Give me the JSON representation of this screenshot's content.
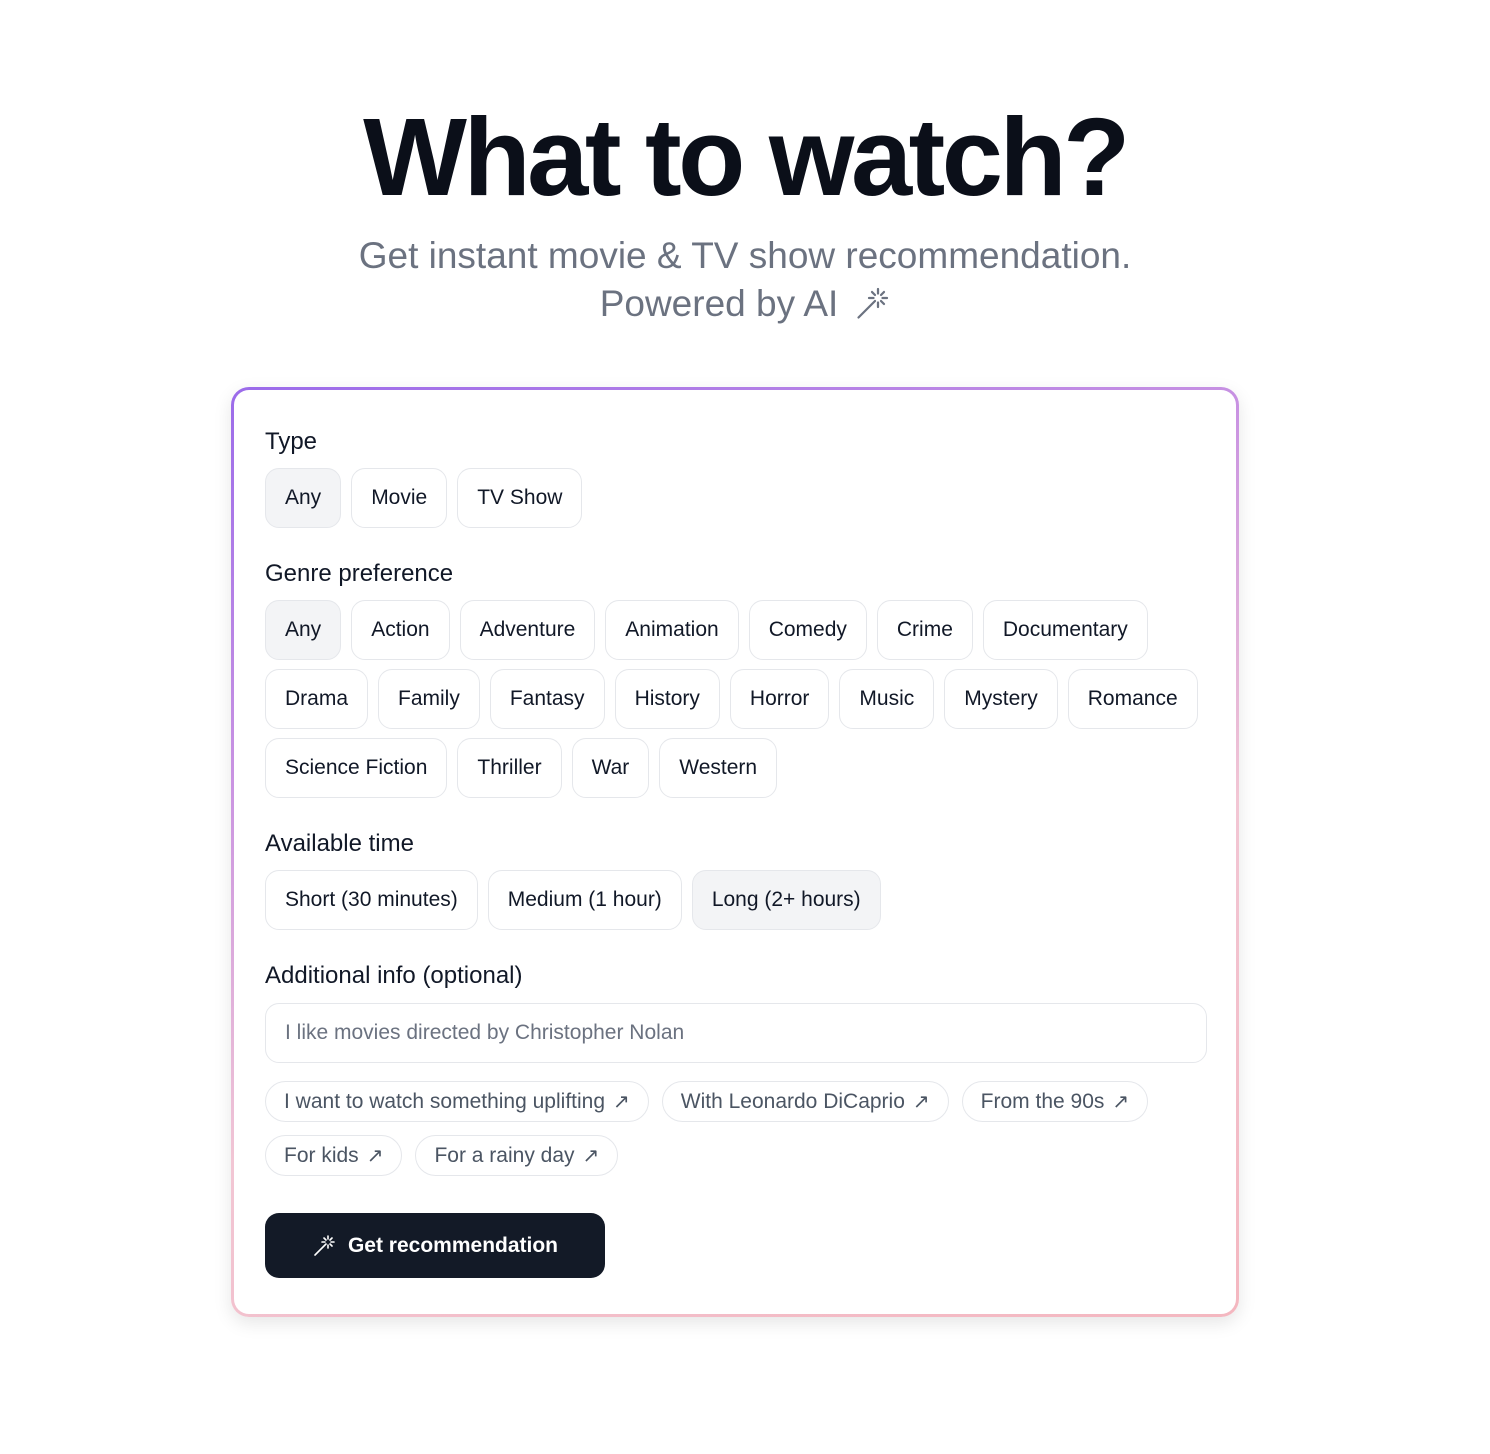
{
  "hero": {
    "title": "What to watch?",
    "subtitle_line1": "Get instant movie & TV show recommendation.",
    "subtitle_line2": "Powered by AI",
    "subtitle_icon": "magic-wand-icon"
  },
  "form": {
    "type": {
      "label": "Type",
      "options": [
        "Any",
        "Movie",
        "TV Show"
      ],
      "selected": "Any"
    },
    "genre": {
      "label": "Genre preference",
      "options": [
        "Any",
        "Action",
        "Adventure",
        "Animation",
        "Comedy",
        "Crime",
        "Documentary",
        "Drama",
        "Family",
        "Fantasy",
        "History",
        "Horror",
        "Music",
        "Mystery",
        "Romance",
        "Science Fiction",
        "Thriller",
        "War",
        "Western"
      ],
      "selected": "Any"
    },
    "time": {
      "label": "Available time",
      "options": [
        "Short (30 minutes)",
        "Medium (1 hour)",
        "Long (2+ hours)"
      ],
      "selected": "Long (2+ hours)"
    },
    "additional": {
      "label": "Additional info (optional)",
      "placeholder": "I like movies directed by Christopher Nolan",
      "value": "",
      "suggestions": [
        "I want to watch something uplifting",
        "With Leonardo DiCaprio",
        "From the 90s",
        "For kids",
        "For a rainy day"
      ],
      "suggestion_arrow": "↗"
    },
    "submit": {
      "label": "Get recommendation",
      "icon": "magic-wand-icon"
    }
  },
  "colors": {
    "primary_button": "#131a27",
    "selected_chip": "#f3f4f6",
    "border_gradient_start": "#9b6bea",
    "border_gradient_end": "#f4b7c0",
    "muted_text": "#6b7280"
  }
}
